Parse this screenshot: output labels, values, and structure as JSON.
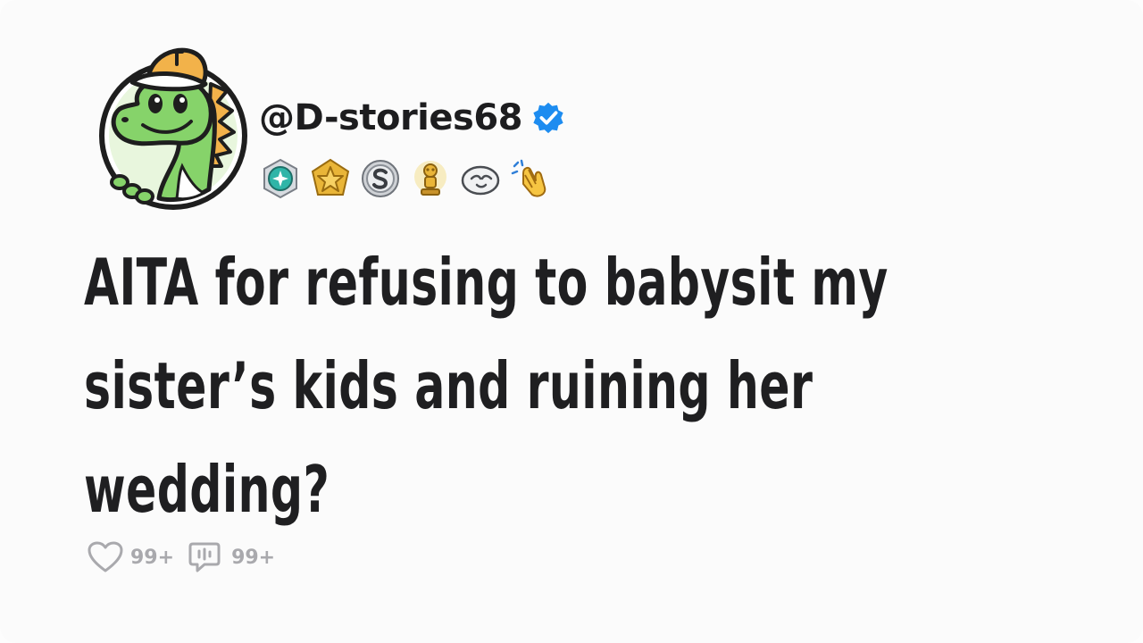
{
  "post": {
    "username": "@D-stories68",
    "title": "AITA for refusing to babysit my sister’s kids and ruining her wedding?",
    "likes": "99+",
    "comments": "99+"
  },
  "icons": {
    "avatar": "dinosaur-avatar",
    "verified": "verified-check-icon",
    "badges": [
      "diamond-badge-icon",
      "star-badge-icon",
      "s-badge-icon",
      "trophy-badge-icon",
      "seal-badge-icon",
      "clap-hands-icon"
    ],
    "like": "heart-icon",
    "comment": "comment-icon"
  },
  "colors": {
    "verified_blue": "#1d8cf0",
    "text": "#1f1f21",
    "muted": "#a9a9ad",
    "dino_green": "#86d36a",
    "cap_orange": "#f2b24a"
  }
}
